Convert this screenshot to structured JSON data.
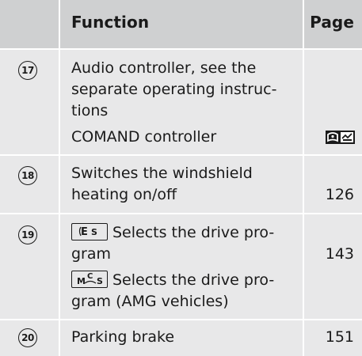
{
  "table": {
    "headers": {
      "function": "Function",
      "page": "Page"
    },
    "rows": [
      {
        "number": "17",
        "line1": "Audio controller, see the",
        "line2": "separate operating instruc-",
        "line3": "tions",
        "line4": "COMAND controller",
        "page_icon": "comand-book-icon"
      },
      {
        "number": "18",
        "line1": "Switches the windshield",
        "line2": "heating on/off",
        "page": "126"
      },
      {
        "number": "19",
        "line1": "Selects the drive pro-",
        "line2": "gram",
        "line3": "Selects the drive pro-",
        "line4": "gram (AMG vehicles)",
        "key1_icon": "ecs-key-icon",
        "key2_icon": "mcs-key-icon",
        "page": "143"
      },
      {
        "number": "20",
        "line1": "Parking brake",
        "page": "151"
      }
    ]
  },
  "colors": {
    "header_bg": "#cfd0d1",
    "row_bg": "#e8e8e9",
    "separator": "#ffffff"
  }
}
